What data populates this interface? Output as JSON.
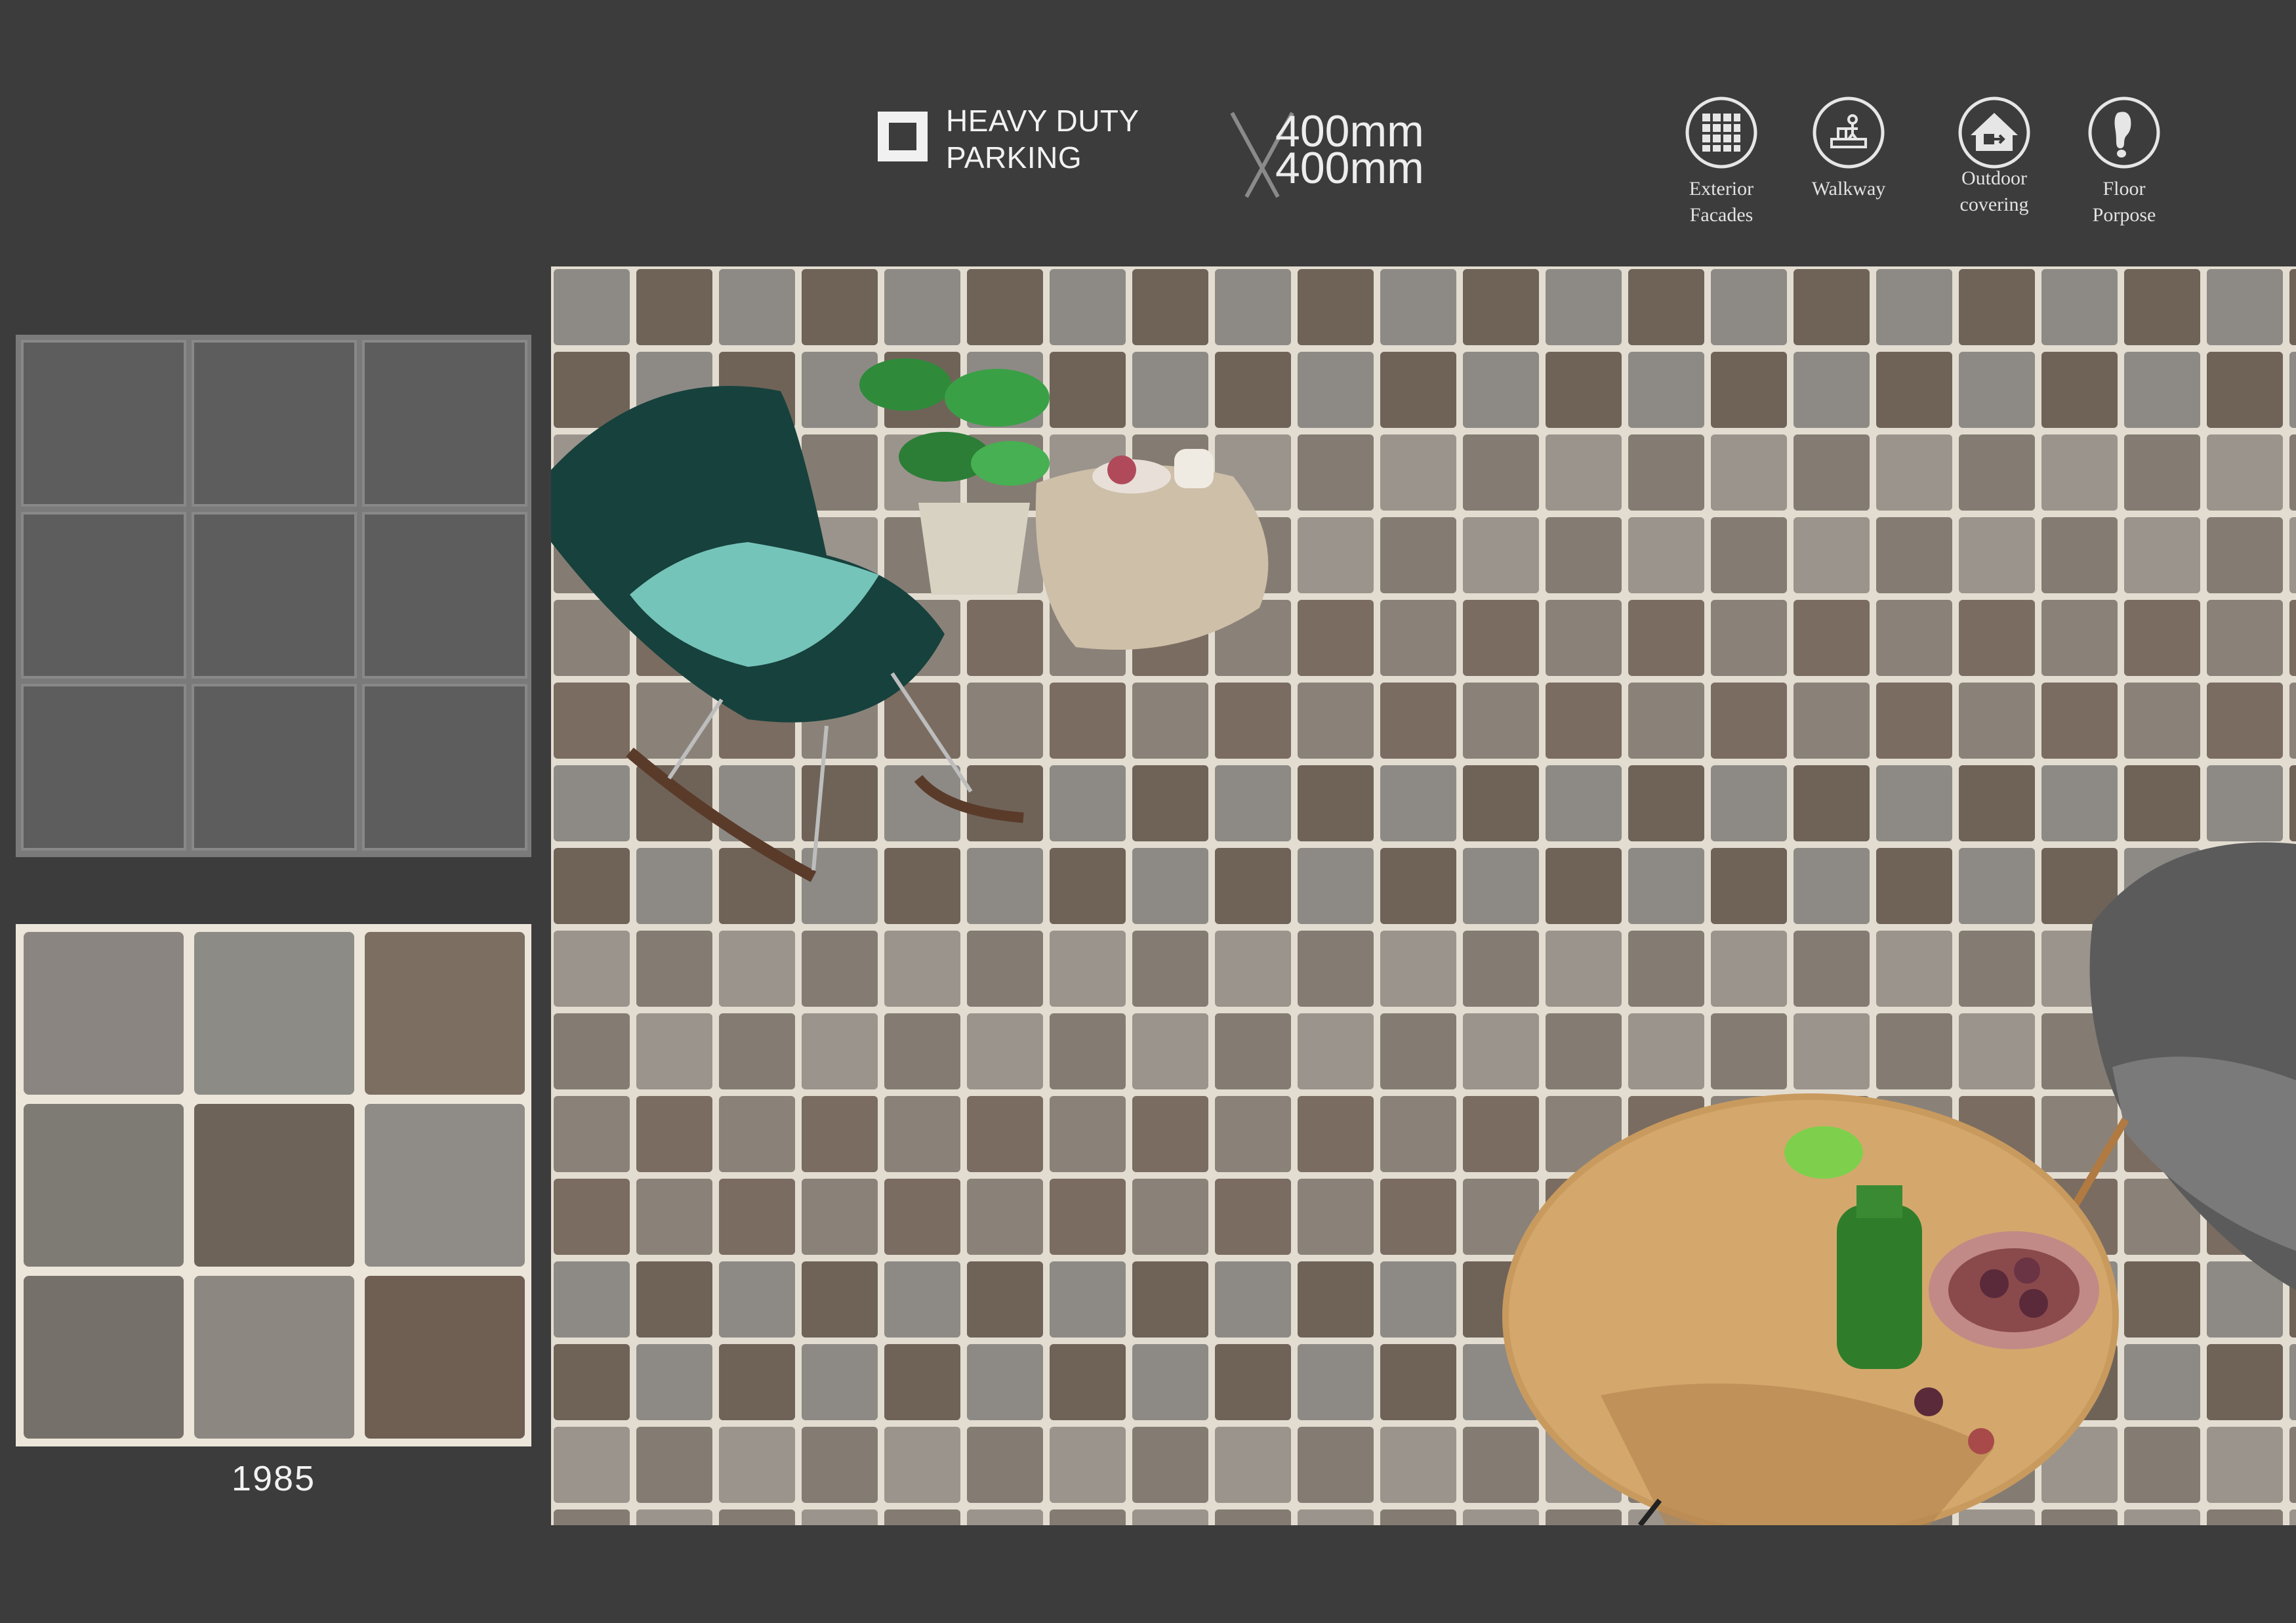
{
  "header": {
    "heavy_duty_line1": "HEAVY DUTY",
    "heavy_duty_line2": "PARKING",
    "size_line1": "400mm",
    "size_line2": "400mm"
  },
  "usage": [
    {
      "icon": "grid-facade-icon",
      "line1": "Exterior",
      "line2": "Facades"
    },
    {
      "icon": "walkway-icon",
      "line1": "Walkway",
      "line2": ""
    },
    {
      "icon": "outdoor-covering-icon",
      "line1": "Outdoor",
      "line2": "covering"
    },
    {
      "icon": "floor-footprint-icon",
      "line1": "Floor",
      "line2": "Porpose"
    }
  ],
  "product": {
    "code": "1985"
  },
  "colors": {
    "background": "#3c3c3c",
    "text": "#f2f2f2",
    "tile_dark": "#5e5e5e",
    "grout": "#e8e2d6"
  }
}
